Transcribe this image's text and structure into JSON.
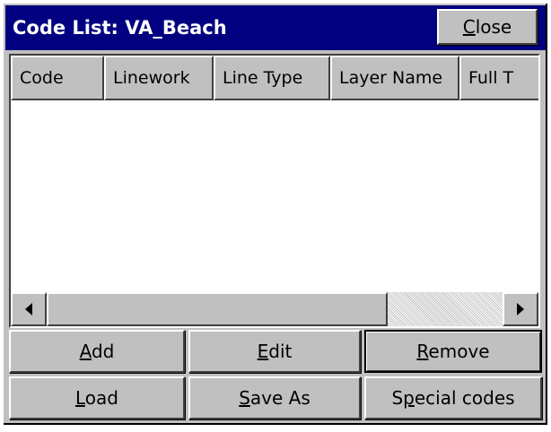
{
  "window": {
    "title": "Code List: VA_Beach",
    "close_label": "Close"
  },
  "list": {
    "columns": [
      "Code",
      "Linework",
      "Line Type",
      "Layer Name",
      "Full T"
    ],
    "rows": []
  },
  "scrollbar": {
    "left_icon": "arrow-left-icon",
    "right_icon": "arrow-right-icon"
  },
  "buttons": {
    "add": "Add",
    "edit": "Edit",
    "remove": "Remove",
    "load": "Load",
    "save_as": "Save As",
    "special_codes": "Special codes"
  },
  "colors": {
    "titlebar": "#000080",
    "face": "#c0c0c0"
  }
}
